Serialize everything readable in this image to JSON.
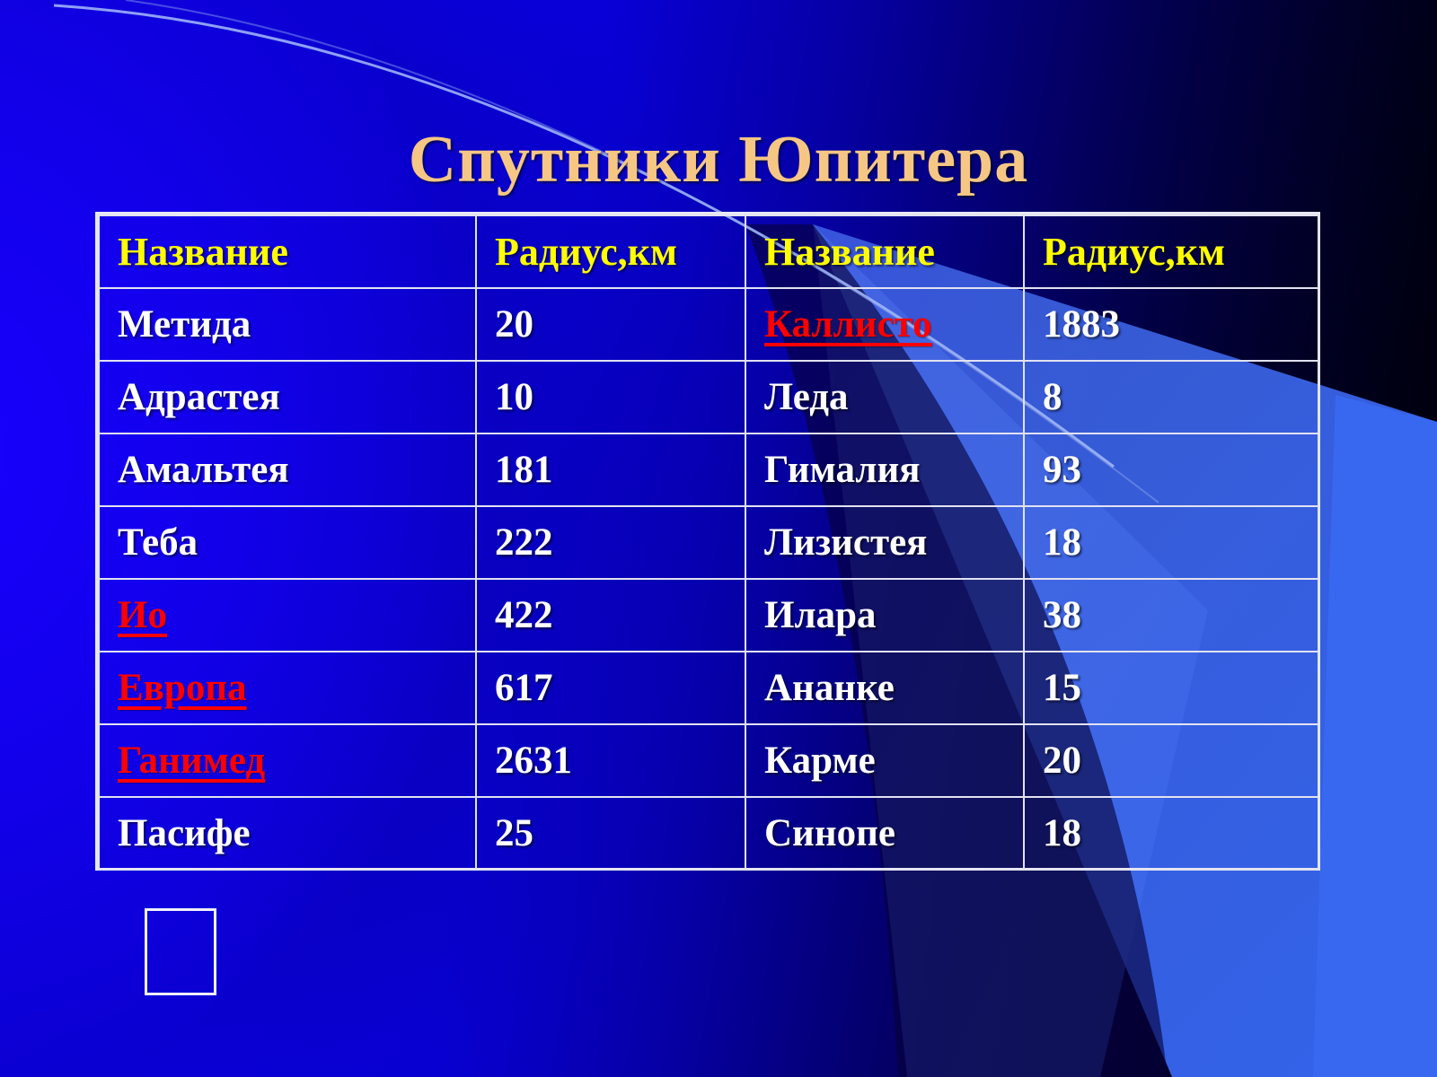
{
  "slide": {
    "title": "Спутники Юпитера",
    "title_color": "#F6C684",
    "background_start_color": "#0B00F4",
    "background_end_color": "#000005",
    "accent_wedge_color": "#3A66EE",
    "arc_line_color": "#9FB4F5"
  },
  "table": {
    "header_color": "#FFFF00",
    "cell_text_color": "#FFFFFF",
    "link_color": "#FF0000",
    "border_color": "#E2E2F0",
    "headers": [
      "Название",
      "Радиус,км",
      "Название",
      "Радиус,км"
    ],
    "rows": [
      {
        "name_left": "Метида",
        "radius_left": "20",
        "name_right": "Каллисто",
        "radius_right": "1883",
        "left_is_link": false,
        "right_is_link": true
      },
      {
        "name_left": "Адрастея",
        "radius_left": "10",
        "name_right": "Леда",
        "radius_right": "8",
        "left_is_link": false,
        "right_is_link": false
      },
      {
        "name_left": "Амальтея",
        "radius_left": "181",
        "name_right": "Гималия",
        "radius_right": "93",
        "left_is_link": false,
        "right_is_link": false
      },
      {
        "name_left": "Теба",
        "radius_left": "222",
        "name_right": "Лизистея",
        "radius_right": "18",
        "left_is_link": false,
        "right_is_link": false
      },
      {
        "name_left": "Ио",
        "radius_left": "422",
        "name_right": "Илара",
        "radius_right": "38",
        "left_is_link": true,
        "right_is_link": false
      },
      {
        "name_left": "Европа",
        "radius_left": "617",
        "name_right": "Ананке",
        "radius_right": "15",
        "left_is_link": true,
        "right_is_link": false
      },
      {
        "name_left": "Ганимед",
        "radius_left": "2631",
        "name_right": "Карме",
        "radius_right": "20",
        "left_is_link": true,
        "right_is_link": false
      },
      {
        "name_left": "Пасифе",
        "radius_left": "25",
        "name_right": "Синопе",
        "radius_right": "18",
        "left_is_link": false,
        "right_is_link": false
      }
    ]
  },
  "placeholder": {
    "label": ""
  }
}
